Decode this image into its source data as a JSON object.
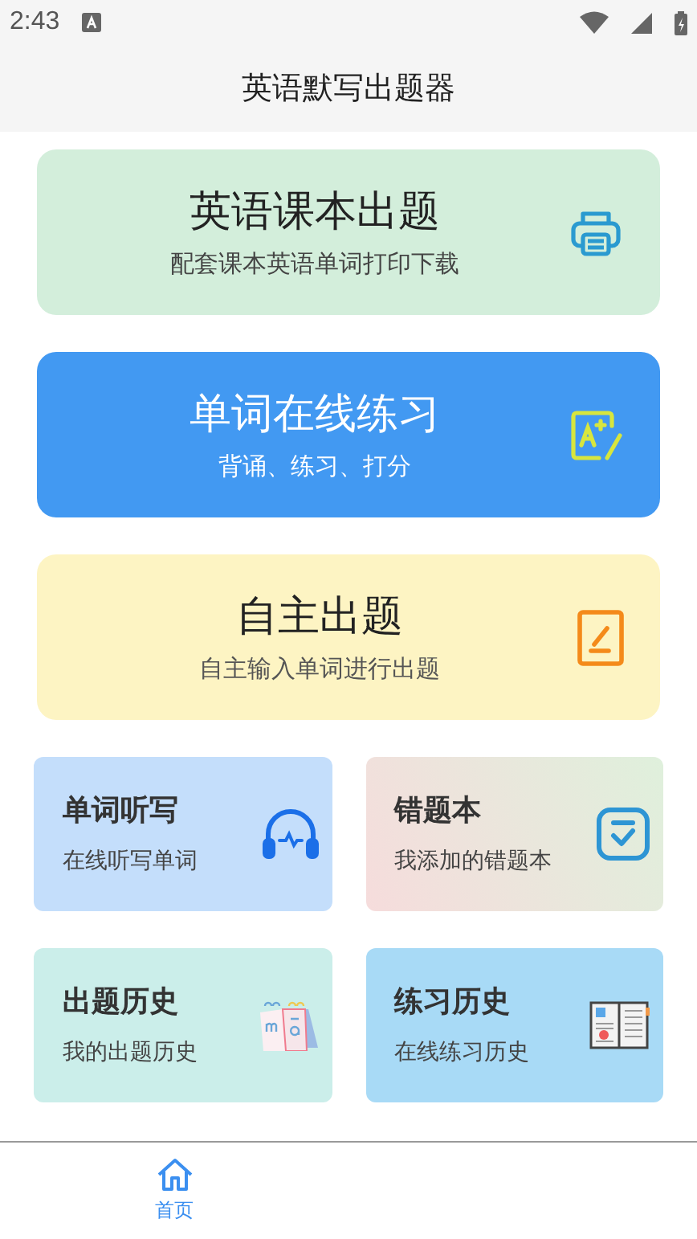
{
  "status_bar": {
    "time": "2:43"
  },
  "header": {
    "title": "英语默写出题器"
  },
  "big_cards": [
    {
      "kind": "print",
      "title": "英语课本出题",
      "subtitle": "配套课本英语单词打印下载"
    },
    {
      "kind": "practice",
      "title": "单词在线练习",
      "subtitle": "背诵、练习、打分"
    },
    {
      "kind": "custom",
      "title": "自主出题",
      "subtitle": "自主输入单词进行出题"
    }
  ],
  "small_cards": [
    {
      "kind": "dictation",
      "title": "单词听写",
      "subtitle": "在线听写单词"
    },
    {
      "kind": "mistakes",
      "title": "错题本",
      "subtitle": "我添加的错题本"
    },
    {
      "kind": "quiz_history",
      "title": "出题历史",
      "subtitle": "我的出题历史"
    },
    {
      "kind": "practice_history",
      "title": "练习历史",
      "subtitle": "在线练习历史"
    }
  ],
  "bottom_nav": [
    {
      "label": "首页",
      "selected": true
    }
  ]
}
